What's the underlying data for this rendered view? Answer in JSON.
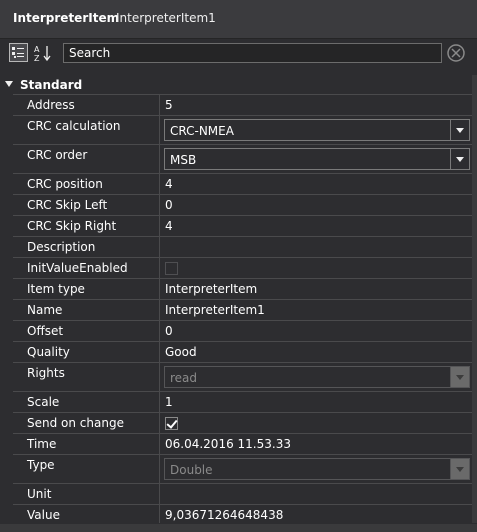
{
  "header": {
    "item_type": "InterpreterItem",
    "item_name": "InterpreterItem1"
  },
  "toolbar": {
    "categorized_icon": "categorized-icon",
    "alphabetical_icon": "sort-alphabetical-icon",
    "search_placeholder": "Search",
    "clear_icon": "clear-search-icon"
  },
  "category": {
    "label": "Standard"
  },
  "properties": [
    {
      "name": "Address",
      "value": "5"
    },
    {
      "name": "CRC calculation",
      "value": "CRC-NMEA",
      "editor": "combo"
    },
    {
      "name": "CRC order",
      "value": "MSB",
      "editor": "combo"
    },
    {
      "name": "CRC position",
      "value": "4"
    },
    {
      "name": "CRC Skip Left",
      "value": "0"
    },
    {
      "name": "CRC Skip Right",
      "value": "4"
    },
    {
      "name": "Description",
      "value": ""
    },
    {
      "name": "InitValueEnabled",
      "checked": false,
      "editor": "checkbox-disabled"
    },
    {
      "name": "Item type",
      "value": "InterpreterItem"
    },
    {
      "name": "Name",
      "value": "InterpreterItem1"
    },
    {
      "name": "Offset",
      "value": "0"
    },
    {
      "name": "Quality",
      "value": "Good"
    },
    {
      "name": "Rights",
      "value": "read",
      "editor": "combo-disabled"
    },
    {
      "name": "Scale",
      "value": "1"
    },
    {
      "name": "Send on change",
      "checked": true,
      "editor": "checkbox"
    },
    {
      "name": "Time",
      "value": "06.04.2016 11.53.33"
    },
    {
      "name": "Type",
      "value": "Double",
      "editor": "combo-disabled"
    },
    {
      "name": "Unit",
      "value": ""
    },
    {
      "name": "Value",
      "value": "9,03671264648438"
    }
  ],
  "colors": {
    "background": "#2d2d30",
    "header": "#3b3b3e",
    "gridline": "#4a4a4c",
    "text": "#ffffff"
  }
}
